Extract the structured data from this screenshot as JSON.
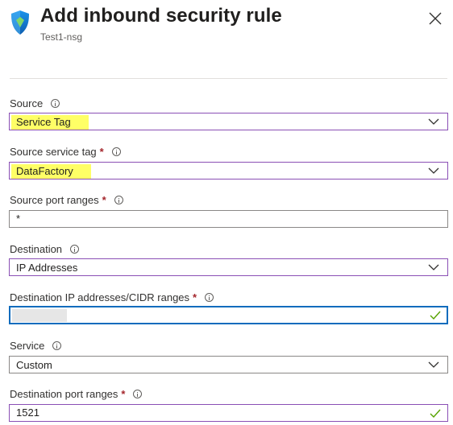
{
  "header": {
    "title": "Add inbound security rule",
    "subtitle": "Test1-nsg",
    "icon": "shield-icon",
    "close_icon": "close-icon"
  },
  "colors": {
    "accent_purple": "#8a4fb5",
    "focus_blue": "#0f6cbd",
    "highlight": "#ffff66",
    "valid_green": "#57a300",
    "required_red": "#a4262c"
  },
  "form": {
    "source": {
      "label": "Source",
      "value": "Service Tag"
    },
    "source_service_tag": {
      "label": "Source service tag",
      "required": "*",
      "value": "DataFactory"
    },
    "source_port_ranges": {
      "label": "Source port ranges",
      "required": "*",
      "value": "*"
    },
    "destination": {
      "label": "Destination",
      "value": "IP Addresses"
    },
    "destination_ip": {
      "label": "Destination IP addresses/CIDR ranges",
      "required": "*",
      "value": ""
    },
    "service": {
      "label": "Service",
      "value": "Custom"
    },
    "destination_port_ranges": {
      "label": "Destination port ranges",
      "required": "*",
      "value": "1521"
    }
  }
}
